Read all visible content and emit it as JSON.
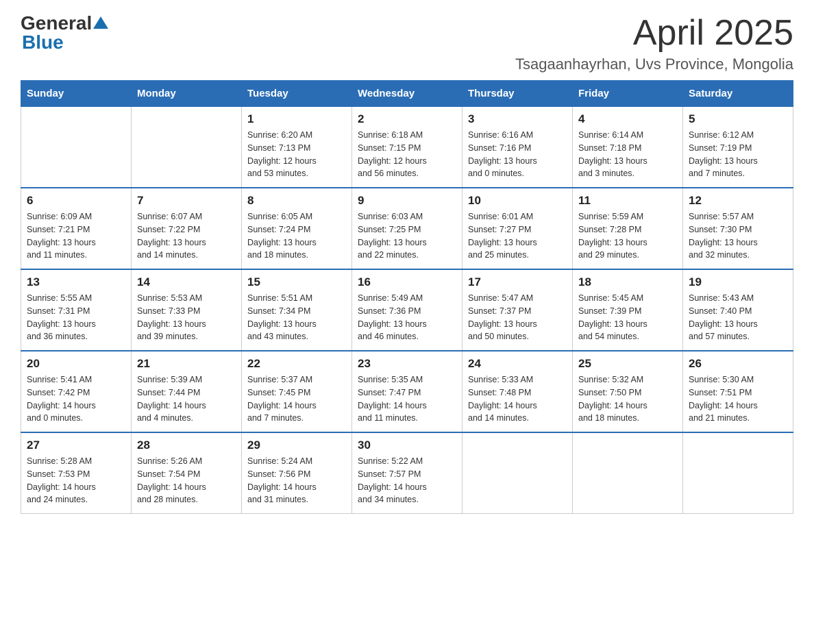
{
  "header": {
    "logo_general": "General",
    "logo_blue": "Blue",
    "month_title": "April 2025",
    "location": "Tsagaanhayrhan, Uvs Province, Mongolia"
  },
  "weekdays": [
    "Sunday",
    "Monday",
    "Tuesday",
    "Wednesday",
    "Thursday",
    "Friday",
    "Saturday"
  ],
  "weeks": [
    [
      {
        "day": "",
        "info": ""
      },
      {
        "day": "",
        "info": ""
      },
      {
        "day": "1",
        "info": "Sunrise: 6:20 AM\nSunset: 7:13 PM\nDaylight: 12 hours\nand 53 minutes."
      },
      {
        "day": "2",
        "info": "Sunrise: 6:18 AM\nSunset: 7:15 PM\nDaylight: 12 hours\nand 56 minutes."
      },
      {
        "day": "3",
        "info": "Sunrise: 6:16 AM\nSunset: 7:16 PM\nDaylight: 13 hours\nand 0 minutes."
      },
      {
        "day": "4",
        "info": "Sunrise: 6:14 AM\nSunset: 7:18 PM\nDaylight: 13 hours\nand 3 minutes."
      },
      {
        "day": "5",
        "info": "Sunrise: 6:12 AM\nSunset: 7:19 PM\nDaylight: 13 hours\nand 7 minutes."
      }
    ],
    [
      {
        "day": "6",
        "info": "Sunrise: 6:09 AM\nSunset: 7:21 PM\nDaylight: 13 hours\nand 11 minutes."
      },
      {
        "day": "7",
        "info": "Sunrise: 6:07 AM\nSunset: 7:22 PM\nDaylight: 13 hours\nand 14 minutes."
      },
      {
        "day": "8",
        "info": "Sunrise: 6:05 AM\nSunset: 7:24 PM\nDaylight: 13 hours\nand 18 minutes."
      },
      {
        "day": "9",
        "info": "Sunrise: 6:03 AM\nSunset: 7:25 PM\nDaylight: 13 hours\nand 22 minutes."
      },
      {
        "day": "10",
        "info": "Sunrise: 6:01 AM\nSunset: 7:27 PM\nDaylight: 13 hours\nand 25 minutes."
      },
      {
        "day": "11",
        "info": "Sunrise: 5:59 AM\nSunset: 7:28 PM\nDaylight: 13 hours\nand 29 minutes."
      },
      {
        "day": "12",
        "info": "Sunrise: 5:57 AM\nSunset: 7:30 PM\nDaylight: 13 hours\nand 32 minutes."
      }
    ],
    [
      {
        "day": "13",
        "info": "Sunrise: 5:55 AM\nSunset: 7:31 PM\nDaylight: 13 hours\nand 36 minutes."
      },
      {
        "day": "14",
        "info": "Sunrise: 5:53 AM\nSunset: 7:33 PM\nDaylight: 13 hours\nand 39 minutes."
      },
      {
        "day": "15",
        "info": "Sunrise: 5:51 AM\nSunset: 7:34 PM\nDaylight: 13 hours\nand 43 minutes."
      },
      {
        "day": "16",
        "info": "Sunrise: 5:49 AM\nSunset: 7:36 PM\nDaylight: 13 hours\nand 46 minutes."
      },
      {
        "day": "17",
        "info": "Sunrise: 5:47 AM\nSunset: 7:37 PM\nDaylight: 13 hours\nand 50 minutes."
      },
      {
        "day": "18",
        "info": "Sunrise: 5:45 AM\nSunset: 7:39 PM\nDaylight: 13 hours\nand 54 minutes."
      },
      {
        "day": "19",
        "info": "Sunrise: 5:43 AM\nSunset: 7:40 PM\nDaylight: 13 hours\nand 57 minutes."
      }
    ],
    [
      {
        "day": "20",
        "info": "Sunrise: 5:41 AM\nSunset: 7:42 PM\nDaylight: 14 hours\nand 0 minutes."
      },
      {
        "day": "21",
        "info": "Sunrise: 5:39 AM\nSunset: 7:44 PM\nDaylight: 14 hours\nand 4 minutes."
      },
      {
        "day": "22",
        "info": "Sunrise: 5:37 AM\nSunset: 7:45 PM\nDaylight: 14 hours\nand 7 minutes."
      },
      {
        "day": "23",
        "info": "Sunrise: 5:35 AM\nSunset: 7:47 PM\nDaylight: 14 hours\nand 11 minutes."
      },
      {
        "day": "24",
        "info": "Sunrise: 5:33 AM\nSunset: 7:48 PM\nDaylight: 14 hours\nand 14 minutes."
      },
      {
        "day": "25",
        "info": "Sunrise: 5:32 AM\nSunset: 7:50 PM\nDaylight: 14 hours\nand 18 minutes."
      },
      {
        "day": "26",
        "info": "Sunrise: 5:30 AM\nSunset: 7:51 PM\nDaylight: 14 hours\nand 21 minutes."
      }
    ],
    [
      {
        "day": "27",
        "info": "Sunrise: 5:28 AM\nSunset: 7:53 PM\nDaylight: 14 hours\nand 24 minutes."
      },
      {
        "day": "28",
        "info": "Sunrise: 5:26 AM\nSunset: 7:54 PM\nDaylight: 14 hours\nand 28 minutes."
      },
      {
        "day": "29",
        "info": "Sunrise: 5:24 AM\nSunset: 7:56 PM\nDaylight: 14 hours\nand 31 minutes."
      },
      {
        "day": "30",
        "info": "Sunrise: 5:22 AM\nSunset: 7:57 PM\nDaylight: 14 hours\nand 34 minutes."
      },
      {
        "day": "",
        "info": ""
      },
      {
        "day": "",
        "info": ""
      },
      {
        "day": "",
        "info": ""
      }
    ]
  ]
}
